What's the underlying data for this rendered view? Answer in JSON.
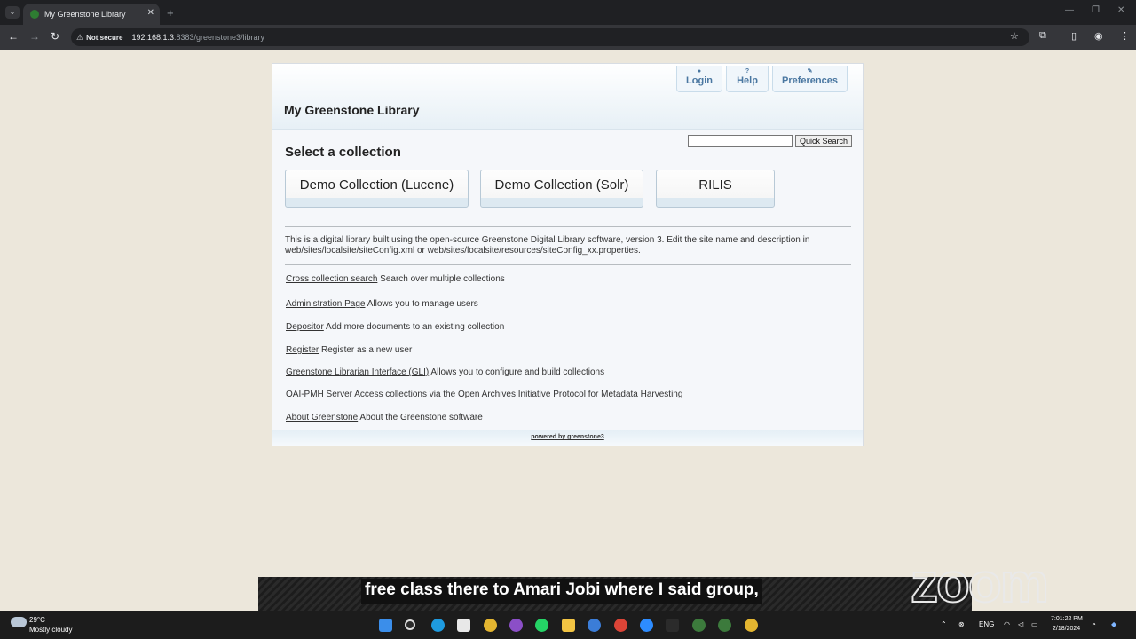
{
  "browser": {
    "tab_title": "My Greenstone Library",
    "new_tab": "+",
    "tab_menu": "⌄",
    "tab_close": "✕",
    "security": "Not secure",
    "url_host": "192.168.1.3",
    "url_path": ":8383/greenstone3/library",
    "nav_icons": [
      "back-icon",
      "forward-icon",
      "reload-icon"
    ],
    "bar_icons": [
      "bookmark-star-icon",
      "extensions-icon",
      "sidebar-icon",
      "profile-icon",
      "menu-icon"
    ]
  },
  "header": {
    "buttons": [
      {
        "label": "Login",
        "icon": "●"
      },
      {
        "label": "Help",
        "icon": "?"
      },
      {
        "label": "Preferences",
        "icon": "✎"
      }
    ],
    "site_title": "My Greenstone Library"
  },
  "search": {
    "value": "",
    "button_label": "Quick Search"
  },
  "collections": {
    "heading": "Select a collection",
    "items": [
      "Demo Collection (Lucene)",
      "Demo Collection (Solr)",
      "RILIS"
    ]
  },
  "description": "This is a digital library built using the open-source Greenstone Digital Library software, version 3. Edit the site name and description in web/sites/localsite/siteConfig.xml or web/sites/localsite/resources/siteConfig_xx.properties.",
  "links": [
    {
      "link": "Cross collection search",
      "text": " Search over multiple collections"
    },
    {
      "link": "Administration Page",
      "text": " Allows you to manage users"
    },
    {
      "link": "Depositor",
      "text": " Add more documents to an existing collection"
    },
    {
      "link": "Register",
      "text": " Register as a new user"
    },
    {
      "link": "Greenstone Librarian Interface (GLI)",
      "text": " Allows you to configure and build collections"
    },
    {
      "link": "OAI-PMH Server",
      "text": " Access collections via the Open Archives Initiative Protocol for Metadata Harvesting"
    },
    {
      "link": "About Greenstone",
      "text": " About the Greenstone software"
    }
  ],
  "footer": "powered by greenstone3",
  "overlay": {
    "caption": "free class there to Amari Jobi where I said group,",
    "logo": "zoom"
  },
  "taskbar": {
    "temperature": "29°C",
    "weather": "Mostly cloudy",
    "language": "ENG",
    "time": "7:01:22 PM",
    "date": "2/18/2024",
    "icons": [
      {
        "name": "start-icon",
        "color": "#3b8eea"
      },
      {
        "name": "search-icon",
        "color": "#2a2a2a"
      },
      {
        "name": "edge-icon",
        "color": "#1e9be0"
      },
      {
        "name": "store-icon",
        "color": "#e8e8e8"
      },
      {
        "name": "chrome-icon",
        "color": "#e3b530"
      },
      {
        "name": "tor-icon",
        "color": "#8b4fc7"
      },
      {
        "name": "whatsapp-icon",
        "color": "#25d366"
      },
      {
        "name": "folder-icon",
        "color": "#f2c443"
      },
      {
        "name": "ccleaner-icon",
        "color": "#3b7dd8"
      },
      {
        "name": "chrome-alt-icon",
        "color": "#db4437"
      },
      {
        "name": "zoom-app-icon",
        "color": "#2d8cff"
      },
      {
        "name": "terminal-icon",
        "color": "#2b2b2b"
      },
      {
        "name": "greenstone-icon",
        "color": "#3c7a3c"
      },
      {
        "name": "greenstone2-icon",
        "color": "#3c7a3c"
      },
      {
        "name": "chrome-profile-icon",
        "color": "#e3b530"
      }
    ]
  }
}
